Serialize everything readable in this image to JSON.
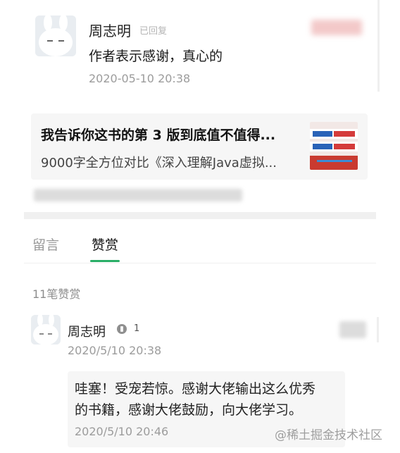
{
  "top_comment": {
    "name": "周志明",
    "status": "已回复",
    "text": "作者表示感谢，真心的",
    "time": "2020-05-10 20:38"
  },
  "article_card": {
    "title": "我告诉你这书的第 3 版到底值不值得...",
    "subtitle": "9000字全方位对比《深入理解Java虚拟..."
  },
  "tabs": [
    {
      "label": "留言",
      "active": false
    },
    {
      "label": "赞赏",
      "active": true
    }
  ],
  "accent_color": "#2aae67",
  "reward_count": "11笔赞赏",
  "reward_entry": {
    "name": "周志明",
    "badge_count": "1",
    "time": "2020/5/10 20:38",
    "reply_text_line1": "哇塞！受宠若惊。感谢大佬输出这么优秀",
    "reply_text_line2": "的书籍，感谢大佬鼓励，向大佬学习。",
    "reply_time": "2020/5/10 20:46"
  },
  "watermark": "@稀土掘金技术社区"
}
